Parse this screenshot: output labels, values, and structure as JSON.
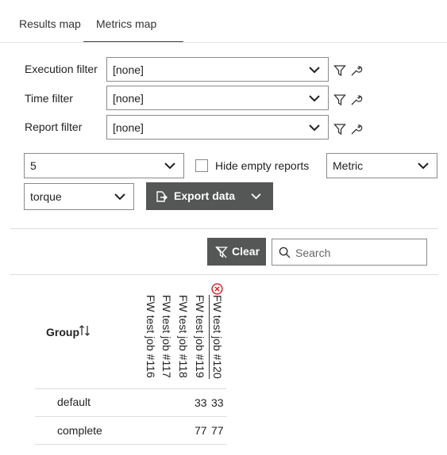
{
  "tabs": [
    {
      "label": "Results map",
      "active": false
    },
    {
      "label": "Metrics map",
      "active": true
    }
  ],
  "filters": [
    {
      "label": "Execution filter",
      "value": "[none]"
    },
    {
      "label": "Time filter",
      "value": "[none]"
    },
    {
      "label": "Report filter",
      "value": "[none]"
    }
  ],
  "controls": {
    "count_value": "5",
    "hide_empty_label": "Hide empty reports",
    "hide_empty_checked": false,
    "mode_value": "Metric",
    "metric_value": "torque",
    "export_label": "Export data"
  },
  "toolbar": {
    "clear_label": "Clear",
    "search_placeholder": "Search"
  },
  "table": {
    "group_header": "Group",
    "columns": [
      "FW test job #116",
      "FW test job #117",
      "FW test job #118",
      "FW test job #119",
      "FW test job #120"
    ],
    "rows": [
      {
        "group": "default",
        "values": [
          "",
          "",
          "",
          "33",
          "33"
        ]
      },
      {
        "group": "complete",
        "values": [
          "",
          "",
          "",
          "77",
          "77"
        ]
      }
    ]
  },
  "colors": {
    "accent_dark": "#555656",
    "remove_icon": "#d6262b"
  },
  "icons": [
    "filter-icon",
    "wrench-icon",
    "chevron-down-icon",
    "export-icon",
    "clear-filter-icon",
    "search-icon",
    "remove-column-icon",
    "sort-icon"
  ]
}
